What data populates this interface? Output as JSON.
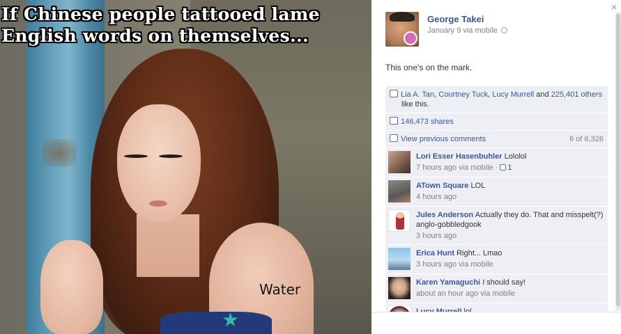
{
  "photo": {
    "meme_line1": "If Chinese people tattooed lame",
    "meme_line2": "English words on themselves...",
    "tattoo_text": "Water"
  },
  "panel": {
    "close_label": "×",
    "poster": {
      "name": "George Takei",
      "time": "January 9 via mobile"
    },
    "status_text": "This one's on the mark.",
    "likes": {
      "name1": "Lia A. Tan",
      "name2": "Courtney Tuck",
      "name3": "Lucy Murrell",
      "others": "225,401 others",
      "suffix": "like this.",
      "and": "and"
    },
    "shares": "146,473 shares",
    "view_previous": "View previous comments",
    "comment_count": "6 of 6,326",
    "comments": [
      {
        "name": "Lori Esser Hasenbuhler",
        "text": "Lololol",
        "meta": "7 hours ago via mobile ·",
        "likes": "1"
      },
      {
        "name": "ATown Square",
        "text": "LOL",
        "meta": "4 hours ago"
      },
      {
        "name": "Jules Anderson",
        "text": "Actually they do. That and misspelt(?) anglo-gobbledgook",
        "meta": "3 hours ago"
      },
      {
        "name": "Erica Hunt",
        "text": "Right... Lmao",
        "meta": "3 hours ago via mobile"
      },
      {
        "name": "Karen Yamaguchi",
        "text": "I should say!",
        "meta": "about an hour ago via mobile"
      },
      {
        "name": "Lucy Murrell",
        "text": "lol",
        "meta": ""
      }
    ]
  },
  "colors": {
    "link": "#3b5998",
    "ufi_bg": "#edeff4",
    "meta_gray": "#808080"
  }
}
